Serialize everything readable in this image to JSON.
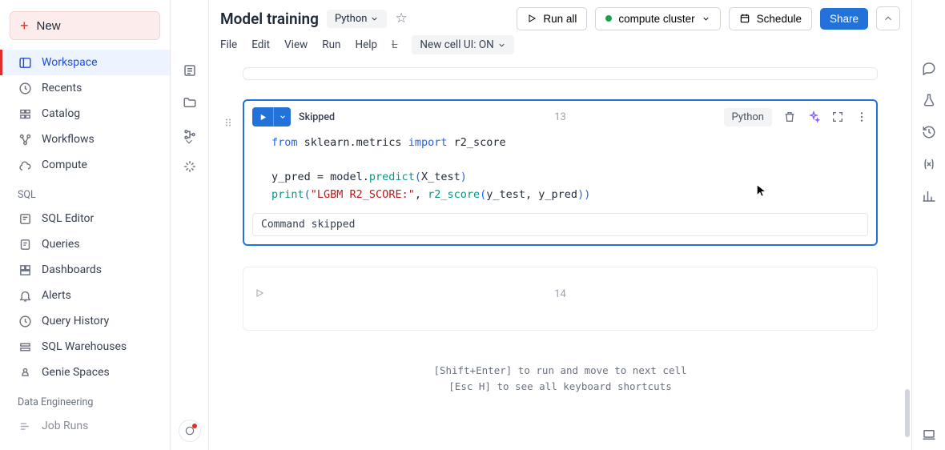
{
  "sidebar": {
    "new_label": "New",
    "primary": [
      {
        "label": "Workspace",
        "icon": "panel"
      },
      {
        "label": "Recents",
        "icon": "clock"
      },
      {
        "label": "Catalog",
        "icon": "catalog"
      },
      {
        "label": "Workflows",
        "icon": "workflow"
      },
      {
        "label": "Compute",
        "icon": "cloud"
      }
    ],
    "sql_header": "SQL",
    "sql_items": [
      {
        "label": "SQL Editor",
        "icon": "sql"
      },
      {
        "label": "Queries",
        "icon": "query"
      },
      {
        "label": "Dashboards",
        "icon": "dashboard"
      },
      {
        "label": "Alerts",
        "icon": "bell"
      },
      {
        "label": "Query History",
        "icon": "clock"
      },
      {
        "label": "SQL Warehouses",
        "icon": "warehouse"
      },
      {
        "label": "Genie Spaces",
        "icon": "genie"
      }
    ],
    "de_header": "Data Engineering",
    "de_items": [
      {
        "label": "Job Runs",
        "icon": "runs"
      }
    ]
  },
  "header": {
    "title": "Model training",
    "language": "Python",
    "menus": [
      "File",
      "Edit",
      "View",
      "Run",
      "Help"
    ],
    "strikethrough_item": "L",
    "cell_ui_label": "New cell UI: ON",
    "run_all_label": "Run all",
    "cluster_label": "compute cluster",
    "schedule_label": "Schedule",
    "share_label": "Share"
  },
  "notebook": {
    "active_cell": {
      "number": "13",
      "status": "Skipped",
      "language_pill": "Python",
      "code_line1_kw1": "from",
      "code_line1_mod": " sklearn.metrics ",
      "code_line1_kw2": "import",
      "code_line1_name": " r2_score",
      "code_line3_a": "y_pred = model.",
      "code_line3_call": "predict",
      "code_line3_b": "(",
      "code_line3_c": "X_test",
      "code_line3_d": ")",
      "code_line4_a": "print",
      "code_line4_b": "(",
      "code_line4_str": "\"LGBM R2_SCORE:\"",
      "code_line4_c": ", ",
      "code_line4_call2": "r2_score",
      "code_line4_d": "(",
      "code_line4_e": "y_test, y_pred",
      "code_line4_f": ")",
      "code_line4_g": ")",
      "output": "Command skipped"
    },
    "next_cell_number": "14",
    "hint1": "[Shift+Enter] to run and move to next cell",
    "hint2": "[Esc H] to see all keyboard shortcuts"
  }
}
